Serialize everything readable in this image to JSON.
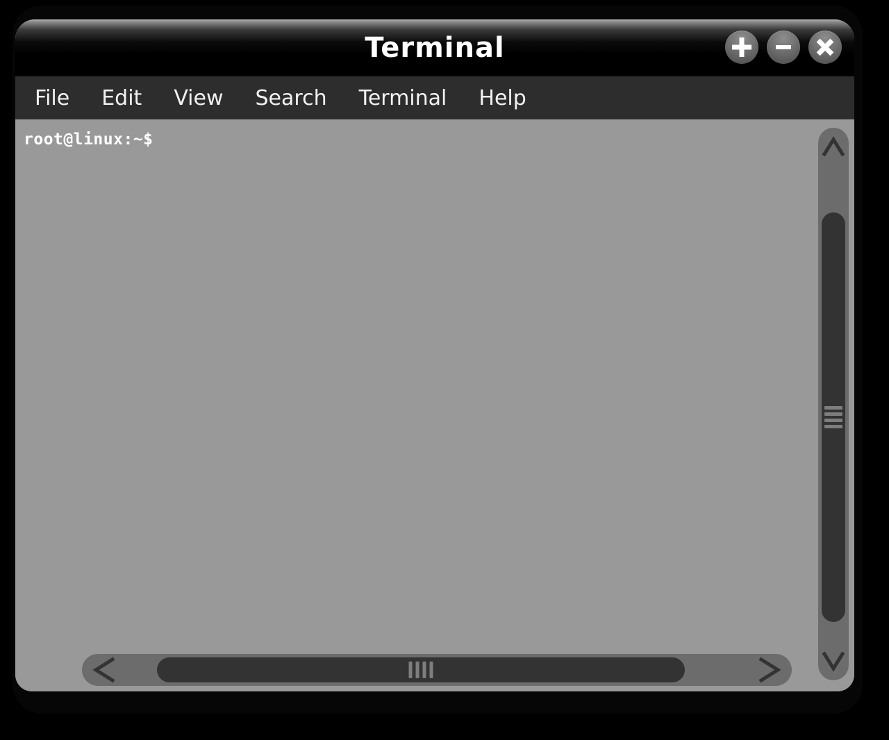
{
  "window": {
    "title": "Terminal",
    "controls": [
      {
        "name": "maximize-button",
        "icon": "plus-icon",
        "label": "+"
      },
      {
        "name": "minimize-button",
        "icon": "minus-icon",
        "label": "−"
      },
      {
        "name": "close-button",
        "icon": "close-icon",
        "label": "✕"
      }
    ]
  },
  "menu": {
    "items": [
      {
        "label": "File"
      },
      {
        "label": "Edit"
      },
      {
        "label": "View"
      },
      {
        "label": "Search"
      },
      {
        "label": "Terminal"
      },
      {
        "label": "Help"
      }
    ]
  },
  "terminal": {
    "prompt": "root@linux:~$",
    "lines": [
      "root@linux:~$"
    ]
  },
  "scrollbars": {
    "vertical": {
      "up_arrow_icon": "chevron-up-icon",
      "down_arrow_icon": "chevron-down-icon",
      "grip_lines": 4
    },
    "horizontal": {
      "left_arrow_icon": "chevron-left-icon",
      "right_arrow_icon": "chevron-right-icon",
      "grip_lines": 4
    }
  },
  "colors": {
    "desktop_background": "#000000",
    "titlebar_top": "#b9b9b9",
    "titlebar_bottom": "#000000",
    "menubar": "#2d2d2d",
    "terminal_background": "#999999",
    "terminal_text": "#ffffff",
    "scrollbar_track": "#6c6c6c",
    "scrollbar_thumb": "#333333",
    "scrollbar_grip": "#7e7e7e"
  }
}
